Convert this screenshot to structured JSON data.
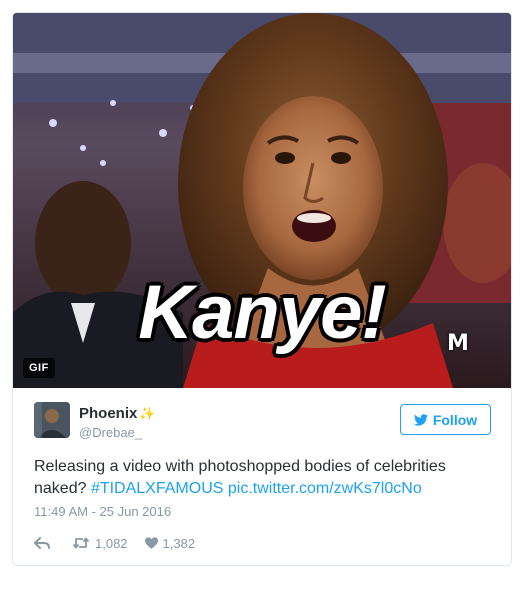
{
  "media": {
    "caption": "Kanye!",
    "gif_badge": "GIF",
    "watermark": "M"
  },
  "user": {
    "name": "Phoenix",
    "sparkle": "✨",
    "handle": "@Drebae_"
  },
  "follow": {
    "label": "Follow"
  },
  "tweet": {
    "text_before": "Releasing a video with photoshopped bodies of celebrities naked? ",
    "hashtag": "#TIDALXFAMOUS",
    "link": "pic.twitter.com/zwKs7l0cNo"
  },
  "timestamp": "11:49 AM - 25 Jun 2016",
  "actions": {
    "retweets": "1,082",
    "likes": "1,382"
  },
  "colors": {
    "accent": "#1da1f2",
    "muted": "#8899a6",
    "text": "#292f33",
    "border": "#e1e8ed"
  }
}
